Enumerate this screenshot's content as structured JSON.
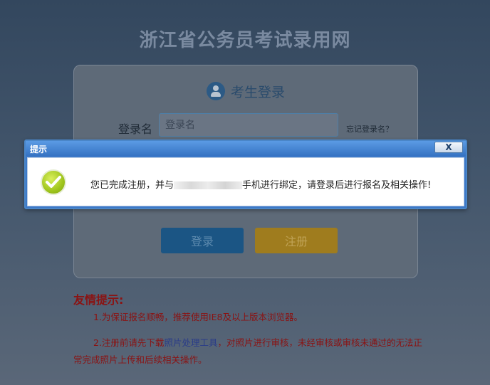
{
  "page": {
    "title": "浙江省公务员考试录用网"
  },
  "login": {
    "title": "考生登录",
    "username_label": "登录名",
    "username_placeholder": "登录名",
    "forgot_link": "忘记登录名？",
    "login_button": "登录",
    "register_button": "注册"
  },
  "tips": {
    "title": "友情提示:",
    "item1": "1.为保证报名顺畅，推荐使用IE8及以上版本浏览器。",
    "item2_before": "2.注册前请先下载",
    "item2_link": "照片处理工具",
    "item2_after": "，对照片进行审核，未经审核或审核未通过的无法正",
    "item2_continued": "常完成照片上传和后续相关操作。"
  },
  "dialog": {
    "title": "提示",
    "close_label": "X",
    "message_before": "您已完成注册，并与",
    "message_after": "手机进行绑定，请登录后进行报名及相关操作!",
    "icon": "checkmark-icon"
  },
  "colors": {
    "dialog_frame": "#3b78c8",
    "tips_text": "#8a1313",
    "login_button": "#1b5584",
    "register_button": "#9f7c1e"
  }
}
